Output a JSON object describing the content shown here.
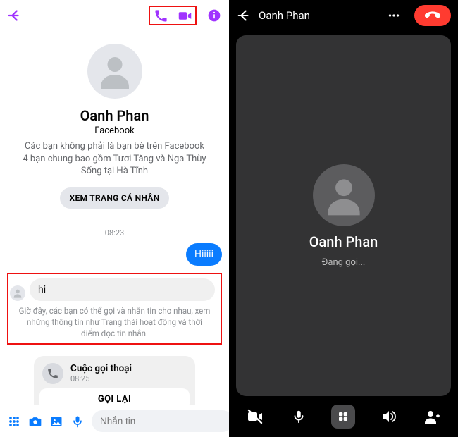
{
  "left": {
    "contact_name": "Oanh Phan",
    "platform": "Facebook",
    "info_line1": "Các bạn không phải là bạn bè trên Facebook",
    "info_line2": "4 bạn chung bao gồm Tươi Tăng và Nga Thùy",
    "info_line3": "Sống tại Hà Tĩnh",
    "view_profile_label": "XEM TRANG CÁ NHÂN",
    "timestamp": "08:23",
    "msg_out": "Hiiiii",
    "msg_in": "hi",
    "system_note": "Giờ đây, các bạn có thể gọi và nhắn tin cho nhau, xem những thông tin như Trạng thái hoạt động và thời điểm đọc tin nhắn.",
    "call_card": {
      "title": "Cuộc gọi thoại",
      "time": "08:25",
      "action": "GỌI LẠI"
    },
    "composer_placeholder": "Nhắn tin"
  },
  "right": {
    "contact_name": "Oanh Phan",
    "call_name": "Oanh Phan",
    "call_status": "Đang gọi..."
  }
}
